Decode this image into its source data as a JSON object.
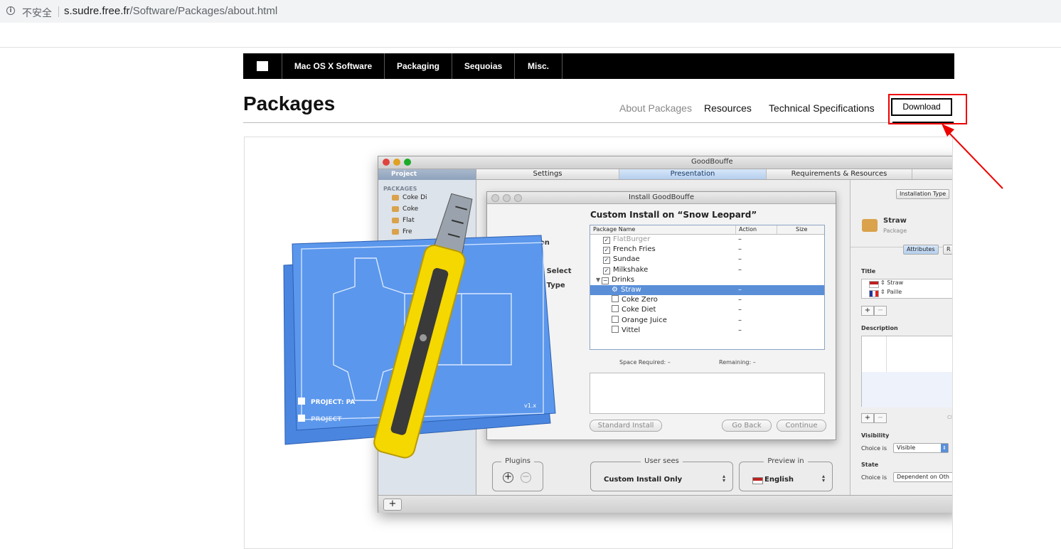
{
  "browser": {
    "security_label": "不安全",
    "url_host": "s.sudre.free.fr",
    "url_path": "/Software/Packages/about.html"
  },
  "nav": {
    "items": [
      {
        "label": "Mac OS X Software"
      },
      {
        "label": "Packaging"
      },
      {
        "label": "Sequoias"
      },
      {
        "label": "Misc."
      }
    ]
  },
  "header": {
    "title": "Packages",
    "links": [
      {
        "label": "About Packages",
        "current": true
      },
      {
        "label": "Resources"
      },
      {
        "label": "Technical Specifications"
      }
    ],
    "download_label": "Download"
  },
  "screenshot": {
    "window_title": "GoodBouffe",
    "sidebar": {
      "project_label": "Project",
      "section_label": "PACKAGES",
      "items": [
        "Coke Di",
        "Coke",
        "Flat",
        "Fre"
      ]
    },
    "tabs": [
      "Settings",
      "Presentation",
      "Requirements & Resources"
    ],
    "dialog": {
      "title": "Install GoodBouffe",
      "heading": "Custom Install on “Snow Leopard”",
      "steps": [
        "Introduction",
        "n Select",
        "n Type"
      ],
      "columns": [
        "Package Name",
        "Action",
        "Size"
      ],
      "rows": [
        {
          "name": "FlatBurger",
          "checked": true,
          "dim": true,
          "action": "–"
        },
        {
          "name": "French Fries",
          "checked": true,
          "action": "–"
        },
        {
          "name": "Sundae",
          "checked": true,
          "action": "–"
        },
        {
          "name": "Milkshake",
          "checked": true,
          "action": "–"
        },
        {
          "name": "Drinks",
          "checked": false,
          "group": true,
          "action": ""
        },
        {
          "name": "Straw",
          "checked": false,
          "selected": true,
          "action": "–"
        },
        {
          "name": "Coke Zero",
          "checked": false,
          "action": "–"
        },
        {
          "name": "Coke Diet",
          "checked": false,
          "action": "–"
        },
        {
          "name": "Orange Juice",
          "checked": false,
          "action": "–"
        },
        {
          "name": "Vittel",
          "checked": false,
          "action": "–"
        }
      ],
      "space_required": "Space Required:  –",
      "remaining": "Remaining:  –",
      "standard_install": "Standard Install",
      "go_back": "Go Back",
      "continue": "Continue"
    },
    "plugins_label": "Plugins",
    "user_sees_label": "User sees",
    "user_sees_value": "Custom Install Only",
    "preview_in_label": "Preview in",
    "preview_in_value": "English",
    "inspector": {
      "installation_type_btn": "Installation Type",
      "package_name": "Straw",
      "package_kind": "Package",
      "attributes_tab": "Attributes",
      "r_tab": "R",
      "title_label": "Title",
      "titles": [
        "Straw",
        "Paille"
      ],
      "description_label": "Description",
      "cl_text": "Cl",
      "visibility_label": "Visibility",
      "choice_is": "Choice is",
      "visibility_value": "Visible",
      "state_label": "State",
      "state_value": "Dependent on Oth"
    },
    "artwork": {
      "project_label": "PROJECT: PA",
      "project_label_back": "PROJECT",
      "version": "v1.x"
    }
  },
  "colors": {
    "nav_bg": "#000000",
    "highlight": "#ee0000",
    "selection_blue": "#5a8fd8",
    "blueprint": "#4f8ee8",
    "cutter_yellow": "#f5d800"
  }
}
